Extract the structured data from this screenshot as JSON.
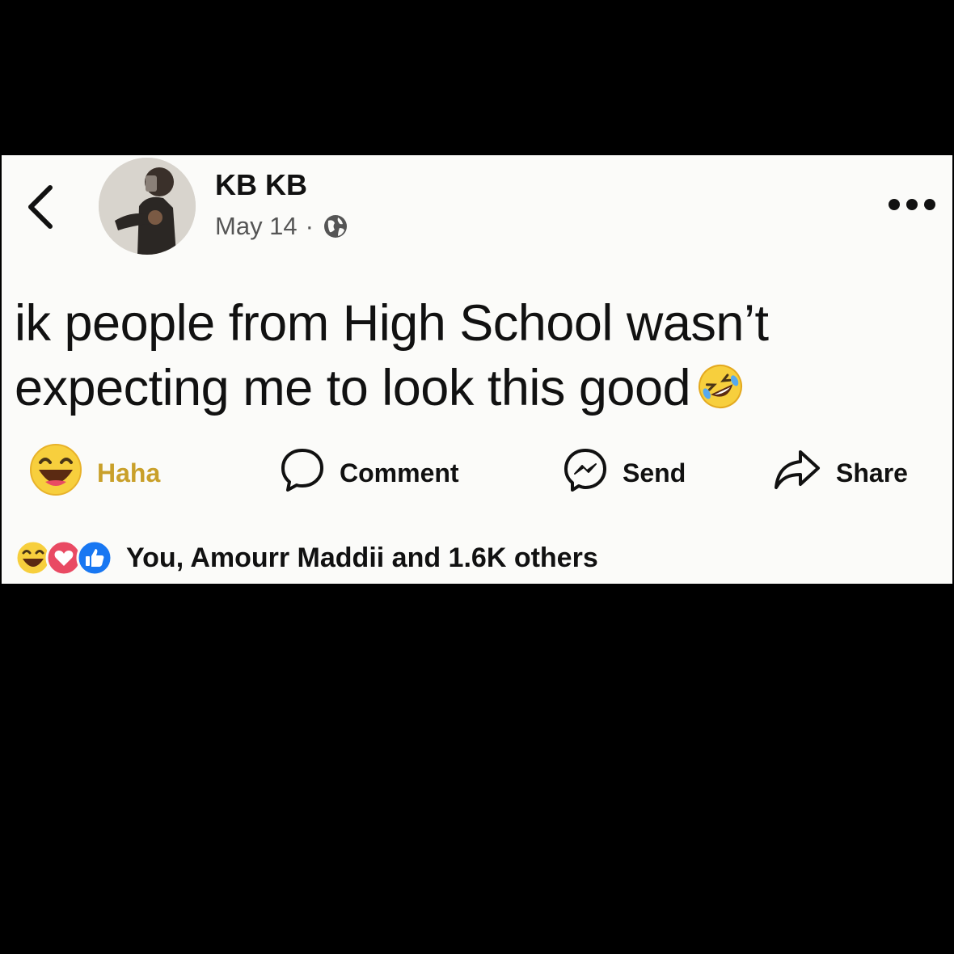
{
  "post": {
    "author": "KB KB",
    "date": "May 14",
    "separator": "·",
    "privacy_icon": "globe-icon",
    "text": "ik people from High School wasn’t expecting me to look this good",
    "text_emoji_icon": "rolling-on-floor-laughing-icon"
  },
  "actions": {
    "reaction_label": "Haha",
    "comment_label": "Comment",
    "send_label": "Send",
    "share_label": "Share"
  },
  "reactions": {
    "icons": [
      "haha-icon",
      "love-icon",
      "like-icon"
    ],
    "summary": "You, Amourr Maddii and 1.6K others"
  },
  "colors": {
    "haha_label": "#c9a02a",
    "love": "#e94a63",
    "like": "#1877f2",
    "emoji_yellow": "#f7cf3d"
  }
}
